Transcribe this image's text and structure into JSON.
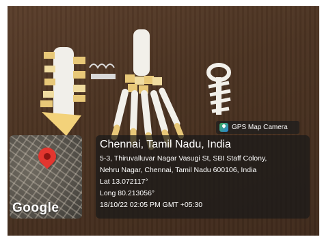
{
  "badge": {
    "icon": "map-camera-icon",
    "label": "GPS Map Camera"
  },
  "location": {
    "city": "Chennai, Tamil Nadu, India",
    "address_line1": "5-3, Thiruvalluvar Nagar Vasugi St, SBI Staff Colony,",
    "address_line2": "Nehru Nagar, Chennai, Tamil Nadu 600106, India",
    "latitude": "Lat 13.072117°",
    "longitude": "Long 80.213056°",
    "timestamp": "18/10/22 02:05 PM GMT +05:30"
  },
  "map": {
    "logo_text": "Google",
    "pin_icon": "location-pin-icon",
    "pin_color": "#e2362f"
  },
  "photo": {
    "subject": "paper craft skeleton models on a table",
    "table_color": "#4b3322",
    "model_color": "#f2f0ea",
    "accent_color": "#e9c26a"
  }
}
